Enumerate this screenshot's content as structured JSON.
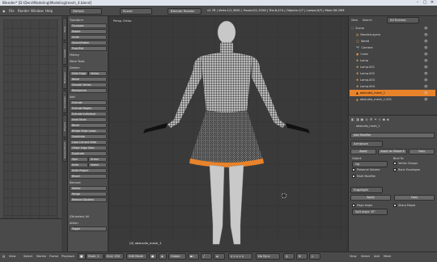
{
  "window": {
    "title": "Blender* [D:\\Deni\\Modeling\\Modeling\\mesh_4.blend]",
    "min": "–",
    "max": "▢",
    "close": "✕"
  },
  "topbar": {
    "menus": [
      "File",
      "Render",
      "Window",
      "Help"
    ],
    "layout": "Default",
    "scene": "Scene",
    "engine": "Blender Render",
    "stats": "v2.78 | Verts:1/1,3061 | Faces:0/1,3258 | Tris:8,474 | Objects:1/7 | Lamps:0/3 | Mem:36.29M | obstudio_mesh_1"
  },
  "toolshelf": {
    "sections": {
      "transform": "Transform",
      "history": "History",
      "mesh_tools": "Mesh Tools",
      "deform": "Deform",
      "add": "Add",
      "remove": "Remove"
    },
    "transform_buttons": [
      "Translate",
      "Rotate",
      "Scale",
      "Shrink/Fatten",
      "Push/Pull"
    ],
    "deform_buttons": [
      "Slide Edge",
      "Vertex",
      "Noise",
      "Smooth Vertex",
      "Randomize"
    ],
    "add_buttons": [
      "Extrude",
      "Extrude Region",
      "Extrude Individual",
      "Inset Faces",
      "Bevel",
      "Bridge Edge Loops",
      "Subdivide",
      "Loop Cut and Slide",
      "Offset Edge Slide",
      "Duplicate",
      "Spin",
      "Screw",
      "Knife",
      "Select",
      "Knife Project",
      "Bisect"
    ],
    "remove_buttons": [
      "Delete",
      "Merge",
      "Remove Doubles"
    ],
    "bottom_panel_title": "(De)select All",
    "action_label": "Action",
    "action_value": "Toggle"
  },
  "tabs": [
    "Tools",
    "Create",
    "Relations",
    "Animation",
    "Physics",
    "Grease Pencil"
  ],
  "viewport": {
    "label": "Persp Ortho",
    "object_label": "(0) obstudio_mesh_1"
  },
  "bottombar": {
    "menus": [
      "View",
      "Select",
      "Add",
      "Mesh"
    ],
    "left_menus": [
      "View",
      "Select",
      "Marker",
      "Frame",
      "Playback"
    ],
    "start_label": "Start:",
    "start_value": "1",
    "end_label": "End:",
    "end_value": "250",
    "mode": "Edit Mode",
    "pivot": "Global",
    "layers": "No Sync"
  },
  "outliner": {
    "menus": [
      "View",
      "Search",
      "All Scenes"
    ],
    "items": [
      {
        "name": "Scene",
        "selected": false
      },
      {
        "name": "RenderLayers",
        "selected": false
      },
      {
        "name": "World",
        "selected": false
      },
      {
        "name": "Camera",
        "selected": false
      },
      {
        "name": "Cube",
        "selected": false
      },
      {
        "name": "Lamp",
        "selected": false
      },
      {
        "name": "Lamp.001",
        "selected": false
      },
      {
        "name": "Lamp.002",
        "selected": false
      },
      {
        "name": "Lamp.003",
        "selected": false
      },
      {
        "name": "Lamp.004",
        "selected": false
      },
      {
        "name": "obstudio_mesh_1",
        "selected": true
      },
      {
        "name": "obstudio_mesh_1.001",
        "selected": false
      }
    ]
  },
  "properties": {
    "object_name": "obstudio_mesh_1",
    "add_modifier": "Add Modifier",
    "modifier1": {
      "name": "Armature",
      "apply": "Apply",
      "apply_shape": "Apply as Shape K",
      "copy": "Copy",
      "object_label": "Object:",
      "object_value": "rig",
      "bind_to": "Bind To:",
      "preserve_volume": "Preserve Volume",
      "multi_modifier": "Multi Modifier",
      "vertex_groups": "Vertex Groups",
      "bone_envelopes": "Bone Envelopes"
    },
    "modifier2": {
      "name": "EdgeSplit",
      "apply": "Apply",
      "copy": "Copy",
      "edge_angle": "Edge Angle",
      "sharp_edges": "Sharp Edges",
      "angle_value": "Split Angle: 30°"
    }
  },
  "colors": {
    "accent": "#e8832a",
    "panel": "#4a4a4a",
    "viewport": "#3b3b3b"
  }
}
